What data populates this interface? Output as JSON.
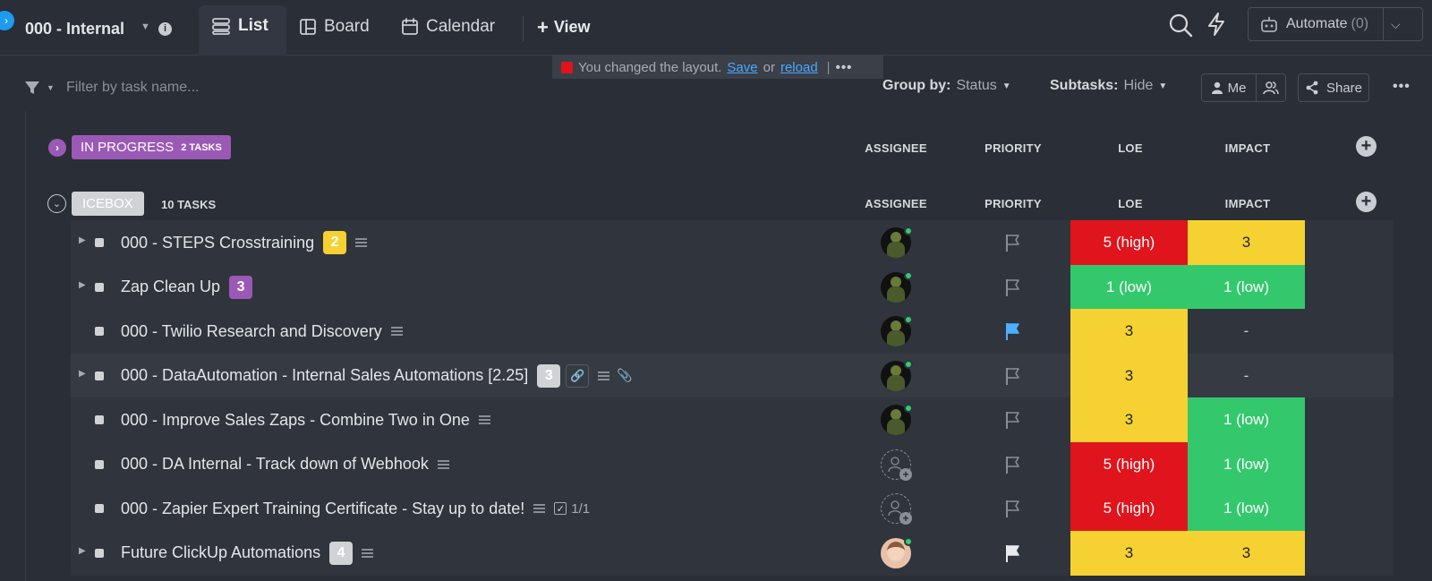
{
  "header": {
    "space_title": "000 - Internal",
    "tabs": [
      {
        "label": "List",
        "icon": "list-icon"
      },
      {
        "label": "Board",
        "icon": "board-icon"
      },
      {
        "label": "Calendar",
        "icon": "calendar-icon"
      }
    ],
    "add_view_label": "View",
    "automate_label": "Automate",
    "automate_count": "(0)"
  },
  "toast": {
    "message": "You changed the layout.",
    "save_label": "Save",
    "or_label": "or",
    "reload_label": "reload",
    "separator": "|"
  },
  "toolbar": {
    "filter_placeholder": "Filter by task name...",
    "group_by_label": "Group by:",
    "group_by_value": "Status",
    "subtasks_label": "Subtasks:",
    "subtasks_value": "Hide",
    "me_label": "Me",
    "share_label": "Share"
  },
  "columns": [
    "ASSIGNEE",
    "PRIORITY",
    "LOE",
    "IMPACT"
  ],
  "groups": [
    {
      "status": "IN PROGRESS",
      "count": "2 TASKS",
      "color": "#9b59b6",
      "collapsed": true
    },
    {
      "status": "ICEBOX",
      "count": "10 TASKS",
      "color": "#d0d2d6",
      "collapsed": false
    }
  ],
  "tasks": [
    {
      "name": "000 - STEPS Crosstraining",
      "subtasks": "2",
      "badge_color": "#f5d231",
      "loe": "5 (high)",
      "impact": "3",
      "assignee": "avatar",
      "priority": "none"
    },
    {
      "name": "Zap Clean Up",
      "subtasks": "3",
      "badge_color": "#9b59b6",
      "loe": "1 (low)",
      "impact": "1 (low)",
      "assignee": "avatar",
      "priority": "none"
    },
    {
      "name": "000 - Twilio Research and Discovery",
      "loe": "3",
      "impact": "-",
      "assignee": "avatar",
      "priority": "normal"
    },
    {
      "name": "000 - DataAutomation - Internal Sales Automations [2.25]",
      "subtasks": "3",
      "badge_color": "#d0d2d6",
      "loe": "3",
      "impact": "-",
      "assignee": "avatar",
      "priority": "none"
    },
    {
      "name": "000 - Improve Sales Zaps - Combine Two in One",
      "loe": "3",
      "impact": "1 (low)",
      "assignee": "avatar",
      "priority": "none"
    },
    {
      "name": "000 - DA Internal - Track down of Webhook",
      "loe": "5 (high)",
      "impact": "1 (low)",
      "assignee": "unassigned",
      "priority": "none"
    },
    {
      "name": "000 - Zapier Expert Training Certificate - Stay up to date!",
      "checklist": "1/1",
      "loe": "5 (high)",
      "impact": "1 (low)",
      "assignee": "unassigned",
      "priority": "none"
    },
    {
      "name": "Future ClickUp Automations",
      "subtasks": "4",
      "badge_color": "#d0d2d6",
      "loe": "3",
      "impact": "3",
      "assignee": "avatar-woman",
      "priority": "low"
    }
  ],
  "colors": {
    "red": "#e0141c",
    "yellow": "#f5d231",
    "green": "#34c86d",
    "purple": "#9b59b6",
    "accent": "#1d9bf0"
  }
}
